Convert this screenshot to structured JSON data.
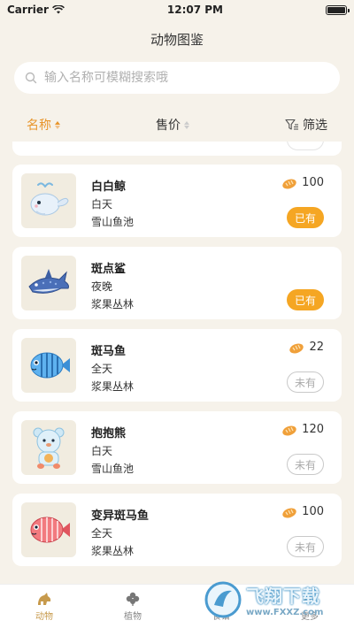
{
  "status_bar": {
    "carrier": "Carrier",
    "time": "12:07 PM"
  },
  "nav": {
    "title": "动物图鉴"
  },
  "search": {
    "placeholder": "输入名称可模糊搜索哦"
  },
  "sort": {
    "name_label": "名称",
    "price_label": "售价",
    "filter_label": "筛选"
  },
  "animals": [
    {
      "name": "白白鲸",
      "time": "白天",
      "place": "雪山鱼池",
      "price": "100",
      "status": "已有",
      "owned": true,
      "icon": "white-whale-icon"
    },
    {
      "name": "斑点鲨",
      "time": "夜晚",
      "place": "浆果丛林",
      "price": "",
      "status": "已有",
      "owned": true,
      "icon": "spotted-shark-icon"
    },
    {
      "name": "斑马鱼",
      "time": "全天",
      "place": "浆果丛林",
      "price": "22",
      "status": "未有",
      "owned": false,
      "icon": "zebra-fish-icon"
    },
    {
      "name": "抱抱熊",
      "time": "白天",
      "place": "雪山鱼池",
      "price": "120",
      "status": "未有",
      "owned": false,
      "icon": "hug-bear-icon"
    },
    {
      "name": "变异斑马鱼",
      "time": "全天",
      "place": "浆果丛林",
      "price": "100",
      "status": "未有",
      "owned": false,
      "icon": "mutant-zebra-fish-icon"
    }
  ],
  "tabs": [
    {
      "label": "动物",
      "icon": "animal-icon",
      "active": true
    },
    {
      "label": "植物",
      "icon": "clover-icon",
      "active": false
    },
    {
      "label": "食谱",
      "icon": "recipe-icon",
      "active": false
    },
    {
      "label": "更多",
      "icon": "more-icon",
      "active": false
    }
  ],
  "watermark": {
    "text": "飞翔下载",
    "url": "www.FXXZ.com"
  },
  "colors": {
    "accent": "#f5a623",
    "active_sort": "#e8952b",
    "background": "#f6f2ea"
  }
}
